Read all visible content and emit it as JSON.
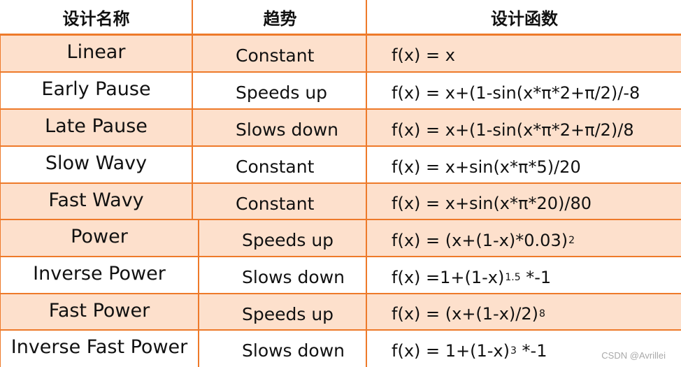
{
  "header": {
    "col_name": "设计名称",
    "col_trend": "趋势",
    "col_function": "设计函数"
  },
  "rows": [
    {
      "name": "Linear",
      "trend": "Constant",
      "function": "f(x) = x"
    },
    {
      "name": "Early Pause",
      "trend": "Speeds up",
      "function": "f(x) = x+(1-sin(x*π*2+π/2)/-8"
    },
    {
      "name": "Late Pause",
      "trend": "Slows down",
      "function": "f(x) = x+(1-sin(x*π*2+π/2)/8"
    },
    {
      "name": "Slow Wavy",
      "trend": "Constant",
      "function": "f(x) = x+sin(x*π*5)/20"
    },
    {
      "name": "Fast Wavy",
      "trend": "Constant",
      "function": "f(x) = x+sin(x*π*20)/80"
    },
    {
      "name": "Power",
      "trend": "Speeds up",
      "function_base": "f(x) = (x+(1-x)*0.03)",
      "function_exp": "2",
      "function_tail": ""
    },
    {
      "name": "Inverse Power",
      "trend": "Slows down",
      "function_base": "f(x) =1+(1-x)",
      "function_exp": "1.5",
      "function_tail": " *-1"
    },
    {
      "name": "Fast Power",
      "trend": "Speeds up",
      "function_base": "f(x) = (x+(1-x)/2)",
      "function_exp": "8",
      "function_tail": ""
    },
    {
      "name": "Inverse Fast Power",
      "trend": "Slows down",
      "function_base": "f(x) = 1+(1-x)",
      "function_exp": "3",
      "function_tail": " *-1"
    }
  ],
  "colors": {
    "border": "#ee7a2a",
    "shaded_row": "#fde0cc",
    "plain_row": "#ffffff"
  },
  "watermark": "CSDN @Avrillei"
}
